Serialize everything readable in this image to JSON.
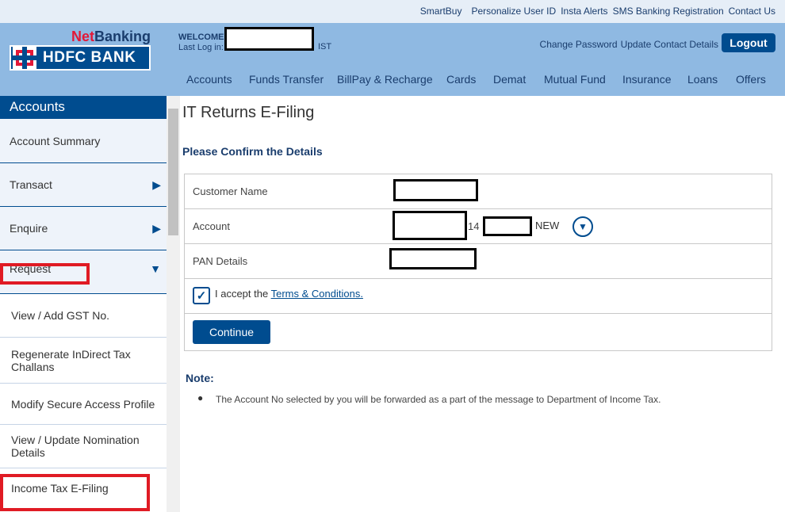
{
  "utility_links": [
    "SmartBuy",
    "Personalize User ID",
    "Insta Alerts",
    "SMS Banking Registration",
    "Contact Us"
  ],
  "brand": {
    "netbanking_prefix": "Net",
    "netbanking_suffix": "Banking",
    "bank_name": "HDFC BANK"
  },
  "welcome": {
    "label": "WELCOME",
    "last_login_label": "Last Log in:",
    "timezone": "IST"
  },
  "account_links": {
    "change_password": "Change Password",
    "update_contact": "Update Contact Details"
  },
  "logout_label": "Logout",
  "main_nav": [
    "Accounts",
    "Funds Transfer",
    "BillPay & Recharge",
    "Cards",
    "Demat",
    "Mutual Fund",
    "Insurance",
    "Loans",
    "Offers"
  ],
  "sidebar": {
    "header": "Accounts",
    "items": [
      {
        "label": "Account Summary"
      },
      {
        "label": "Transact",
        "arrow": "▶"
      },
      {
        "label": "Enquire",
        "arrow": "▶"
      },
      {
        "label": "Request",
        "arrow": "▼"
      }
    ],
    "sub_items": [
      {
        "label": "View / Add GST No."
      },
      {
        "label": "Regenerate InDirect Tax Challans"
      },
      {
        "label": "Modify Secure Access Profile"
      },
      {
        "label": "View / Update Nomination Details"
      },
      {
        "label": "Income Tax E-Filing"
      }
    ]
  },
  "page": {
    "title": "IT Returns E-Filing",
    "subtitle": "Please Confirm the Details",
    "fields": {
      "customer_name_label": "Customer Name",
      "account_label": "Account",
      "account_partial": "14",
      "account_type": "NEW",
      "pan_label": "PAN Details"
    },
    "accept_text": "I accept the",
    "terms_link": "Terms & Conditions.",
    "continue_label": "Continue",
    "note_title": "Note:",
    "note_text": "The Account No selected by you will be forwarded as a part of the message to Department of Income Tax."
  },
  "icons": {
    "checkbox": "check-icon",
    "dropdown": "chevron-down-icon"
  },
  "colors": {
    "primary": "#004c8f",
    "header_bg": "#8fb9e2",
    "highlight": "#e01b24",
    "brand_red": "#e31837"
  }
}
